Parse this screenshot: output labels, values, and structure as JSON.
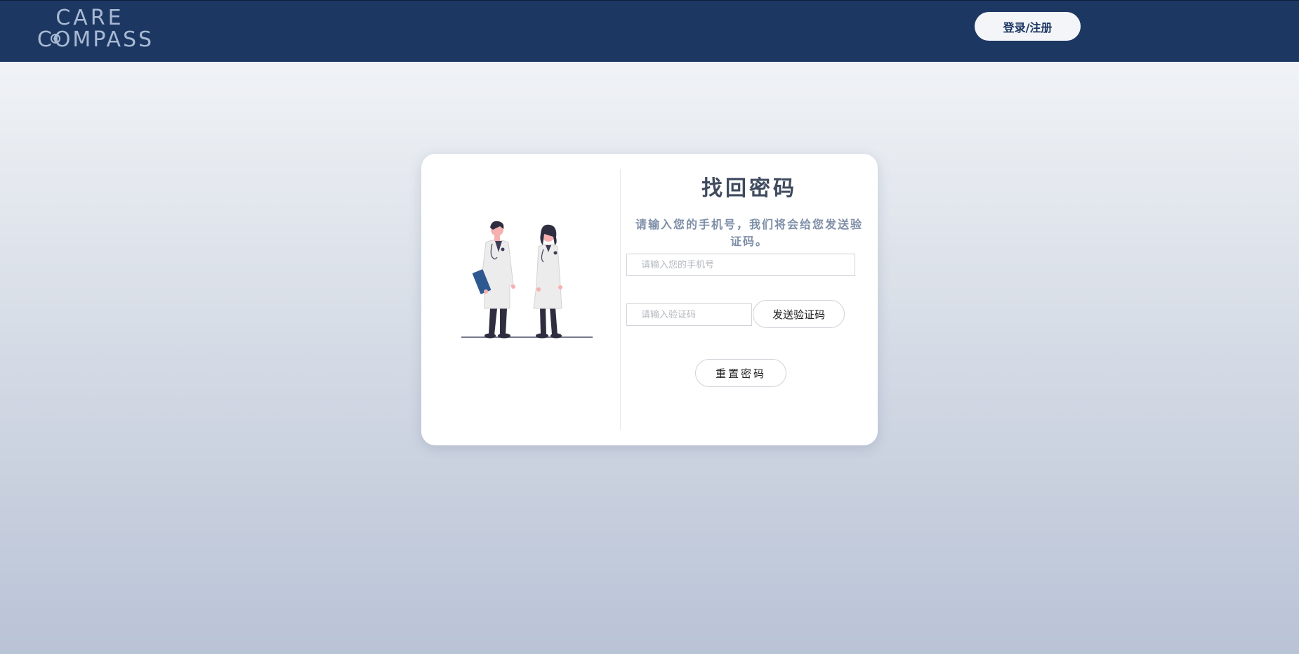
{
  "header": {
    "logo_line1": "CARE",
    "logo_line2": "COMPASS",
    "login_label": "登录/注册"
  },
  "card": {
    "title": "找回密码",
    "subtitle": "请输入您的手机号，我们将会给您发送验证码。",
    "phone_placeholder": "请输入您的手机号",
    "code_placeholder": "请输入验证码",
    "send_code_label": "发送验证码",
    "reset_label": "重置密码"
  },
  "colors": {
    "navbar": "#1c3762",
    "logo": "#a8bad3",
    "title": "#3f4b5e",
    "subtitle": "#7f8fa8"
  },
  "icons": [
    "doctors-illustration",
    "compass-icon"
  ]
}
